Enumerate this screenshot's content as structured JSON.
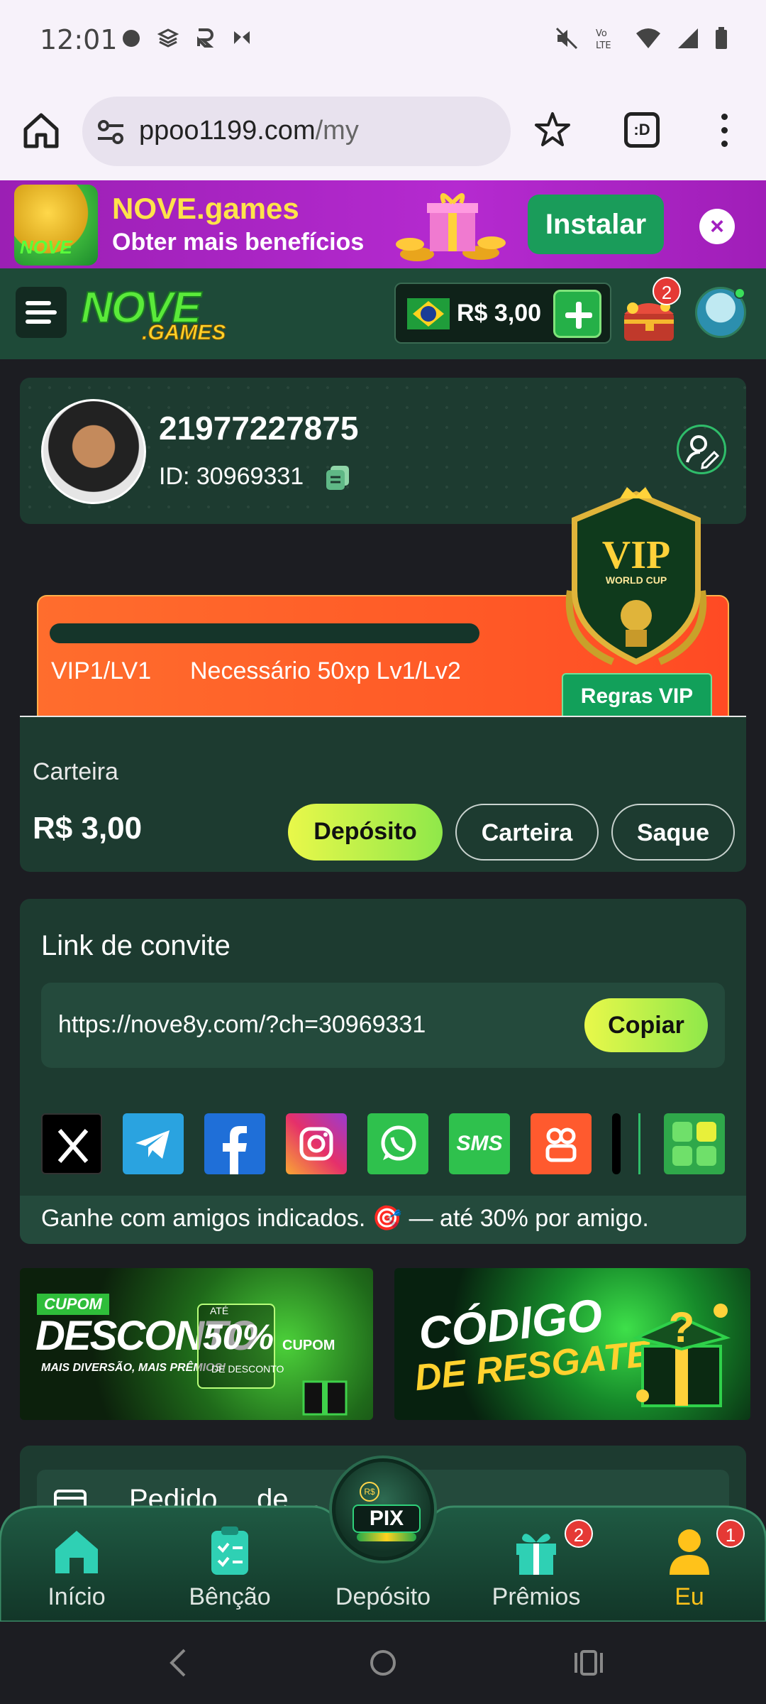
{
  "status_bar": {
    "time": "12:01"
  },
  "browser": {
    "url_host": "ppoo1199.com",
    "url_path": "/my",
    "tabs_label": ":D"
  },
  "install_banner": {
    "app_name": "NOVE.games",
    "subtitle": "Obter mais benefícios",
    "install_label": "Instalar",
    "close_label": "×",
    "logo_text": "NOVE"
  },
  "header": {
    "brand": "NOVE",
    "brand_sub": ".GAMES",
    "balance": "R$ 3,00",
    "chest_badge": "2"
  },
  "profile": {
    "username": "21977227875",
    "user_id": "ID: 30969331"
  },
  "vip": {
    "level": "VIP1/LV1",
    "requirement": "Necessário 50xp Lv1/Lv2",
    "rules_label": "Regras VIP",
    "badge_title": "VIP",
    "badge_sub": "WORLD CUP",
    "progress": 0
  },
  "wallet": {
    "label": "Carteira",
    "amount": "R$ 3,00",
    "deposit_label": "Depósito",
    "wallet_label": "Carteira",
    "withdraw_label": "Saque"
  },
  "invite": {
    "title": "Link de convite",
    "link": "https://nove8y.com/?ch=30969331",
    "copy_label": "Copiar",
    "share_sms": "SMS",
    "footer": "Ganhe com amigos indicados. 🎯 — até 30% por amigo."
  },
  "promos": {
    "coupon_tag": "CUPOM",
    "coupon_title": "DESCONTO",
    "coupon_sub": "MAIS DIVERSÃO, MAIS PRÊMIOS!",
    "coupon_upto": "ATÉ",
    "coupon_pct": "50%",
    "coupon_pct_sub": "DE DESCONTO",
    "coupon_exclusive": "CUPOM",
    "rescue_line1": "CÓDIGO",
    "rescue_line2": "DE RESGATE"
  },
  "next_card": {
    "partial_text": "Pedido ... de ..."
  },
  "bottom_nav": {
    "items": [
      {
        "label": "Início"
      },
      {
        "label": "Bênção"
      },
      {
        "label": "Depósito"
      },
      {
        "label": "Prêmios",
        "badge": "2"
      },
      {
        "label": "Eu",
        "badge": "1"
      }
    ],
    "pix_label": "PIX",
    "pix_rs": "R$",
    "active_color": "#ffc21a"
  }
}
